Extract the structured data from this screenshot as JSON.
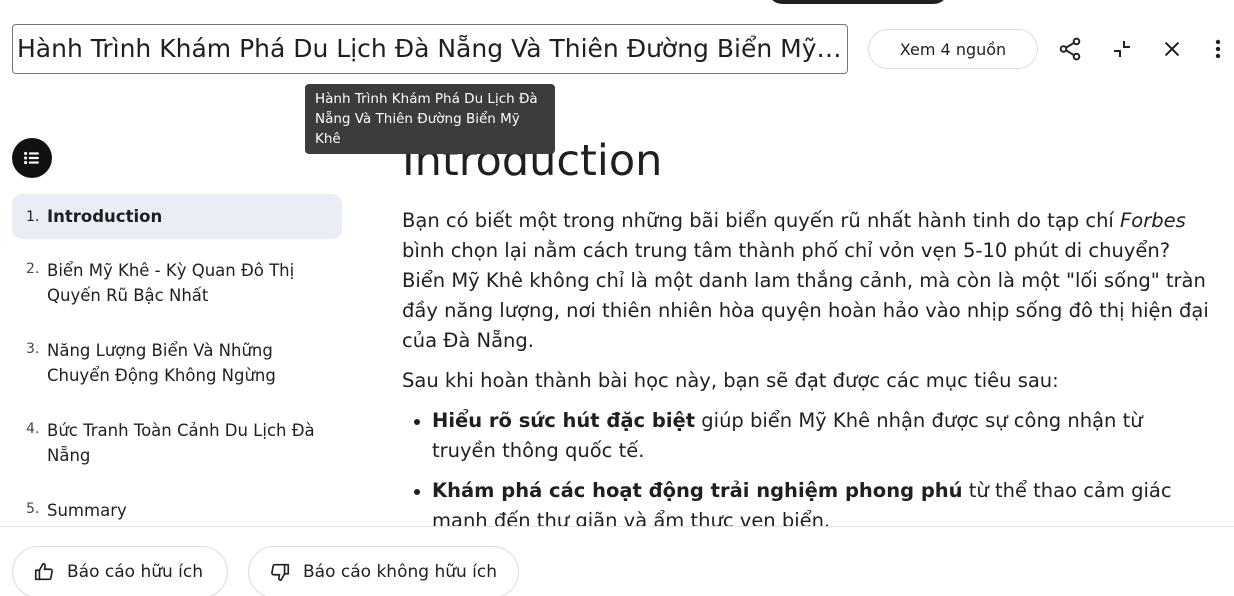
{
  "header": {
    "title": "Hành Trình Khám Phá Du Lịch Đà Nẵng Và Thiên Đường Biển Mỹ K...",
    "sources_label": "Xem 4 nguồn",
    "icons": [
      "share-icon",
      "collapse-icon",
      "close-icon",
      "more-vert-icon"
    ]
  },
  "tooltip": {
    "text": "Hành Trình Khám Phá Du Lịch Đà Nẵng Và Thiên Đường Biển Mỹ Khê"
  },
  "toc": {
    "items": [
      {
        "num": "1.",
        "label": "Introduction"
      },
      {
        "num": "2.",
        "label": "Biển Mỹ Khê - Kỳ Quan Đô Thị Quyến Rũ Bậc Nhất"
      },
      {
        "num": "3.",
        "label": "Năng Lượng Biển Và Những Chuyển Động Không Ngừng"
      },
      {
        "num": "4.",
        "label": "Bức Tranh Toàn Cảnh Du Lịch Đà Nẵng"
      },
      {
        "num": "5.",
        "label": "Summary"
      }
    ]
  },
  "content": {
    "heading": "Introduction",
    "para1": {
      "before": "Bạn có biết một trong những bãi biển quyến rũ nhất hành tinh do tạp chí ",
      "em": "Forbes",
      "after": " bình chọn lại nằm cách trung tâm thành phố chỉ vỏn vẹn 5-10 phút di chuyển? Biển Mỹ Khê không chỉ là một danh lam thắng cảnh, mà còn là một \"lối sống\" tràn đầy năng lượng, nơi thiên nhiên hòa quyện hoàn hảo vào nhịp sống đô thị hiện đại của Đà Nẵng."
    },
    "para2": "Sau khi hoàn thành bài học này, bạn sẽ đạt được các mục tiêu sau:",
    "bullets": [
      {
        "bold": "Hiểu rõ sức hút đặc biệt",
        "rest": " giúp biển Mỹ Khê nhận được sự công nhận từ truyền thông quốc tế."
      },
      {
        "bold": "Khám phá các hoạt động trải nghiệm phong phú",
        "rest": " từ thể thao cảm giác mạnh đến thư giãn và ẩm thực ven biển."
      }
    ]
  },
  "feedback": {
    "helpful": "Báo cáo hữu ích",
    "not_helpful": "Báo cáo không hữu ích"
  }
}
